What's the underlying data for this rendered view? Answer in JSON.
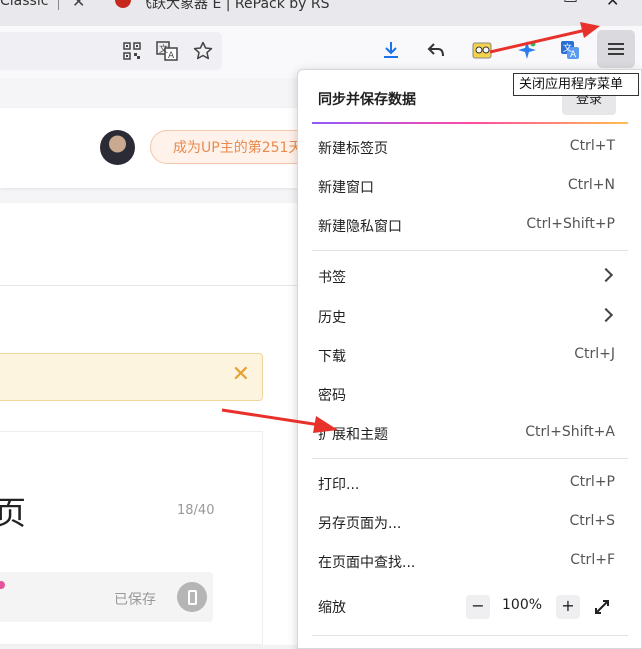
{
  "tabs": {
    "first_tab_title": "Classic",
    "second_tab_title": "飞跃大象器 E | RePack by RS",
    "favicon": "red-badge-icon"
  },
  "toolbar": {
    "icons": [
      "qr-code-icon",
      "translate-icon",
      "bookmark-star-icon",
      "download-icon",
      "undo-icon",
      "extension-puzzle-icon",
      "sparkle-extension-icon",
      "translate-extension-icon",
      "hamburger-menu-icon"
    ]
  },
  "tooltip": {
    "text": "关闭应用程序菜单"
  },
  "page": {
    "up_banner": "成为UP主的第251天",
    "editor_char": "页",
    "char_counter": "18/40",
    "saved_status": "已保存"
  },
  "app_menu": {
    "header_title": "同步并保存数据",
    "signin_label": "登录",
    "items": [
      {
        "label": "新建标签页",
        "shortcut": "Ctrl+T"
      },
      {
        "label": "新建窗口",
        "shortcut": "Ctrl+N"
      },
      {
        "label": "新建隐私窗口",
        "shortcut": "Ctrl+Shift+P"
      },
      {
        "label": "书签",
        "shortcut": ""
      },
      {
        "label": "历史",
        "shortcut": ""
      },
      {
        "label": "下载",
        "shortcut": "Ctrl+J"
      },
      {
        "label": "密码",
        "shortcut": ""
      },
      {
        "label": "扩展和主题",
        "shortcut": "Ctrl+Shift+A"
      },
      {
        "label": "打印...",
        "shortcut": "Ctrl+P"
      },
      {
        "label": "另存页面为...",
        "shortcut": "Ctrl+S"
      },
      {
        "label": "在页面中查找...",
        "shortcut": "Ctrl+F"
      }
    ],
    "zoom": {
      "label": "缩放",
      "minus": "−",
      "level": "100%",
      "plus": "+"
    }
  },
  "colors": {
    "annotation_arrow": "#e8312b",
    "banner_text": "#ea8a4e"
  }
}
